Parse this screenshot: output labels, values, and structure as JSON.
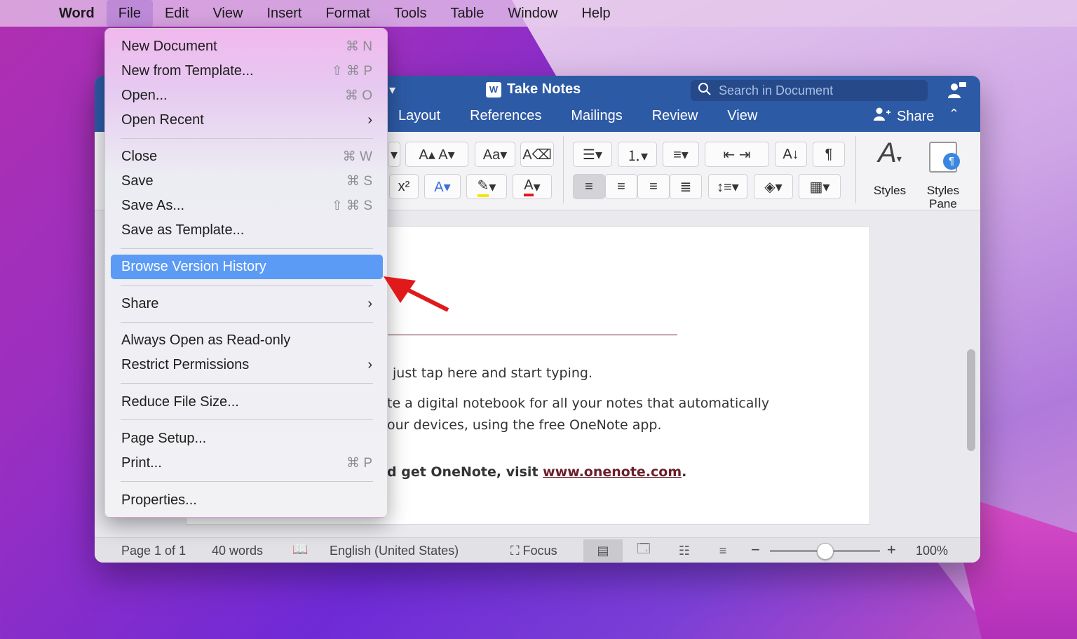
{
  "menubar": {
    "items": [
      "Word",
      "File",
      "Edit",
      "View",
      "Insert",
      "Format",
      "Tools",
      "Table",
      "Window",
      "Help"
    ]
  },
  "window": {
    "title": "Take Notes",
    "search_placeholder": "Search in Document",
    "tabs": [
      "Layout",
      "References",
      "Mailings",
      "Review",
      "View"
    ],
    "share_label": "Share",
    "ribbon": {
      "styles_label": "Styles",
      "styles_pane_label": "Styles Pane"
    }
  },
  "document": {
    "line1": "just tap here and start typing.",
    "line2": "te a digital notebook for all your notes that automatically",
    "line3": "our devices, using the free OneNote app.",
    "line4_prefix": "d get OneNote, visit ",
    "line4_link": "www.onenote.com",
    "line4_suffix": "."
  },
  "status": {
    "page": "Page 1 of 1",
    "words": "40 words",
    "language": "English (United States)",
    "focus": "Focus",
    "zoom": "100%",
    "zoom_level": 0.5
  },
  "file_menu": {
    "items": [
      {
        "label": "New Document",
        "shortcut": "⌘ N"
      },
      {
        "label": "New from Template...",
        "shortcut": "⇧ ⌘ P"
      },
      {
        "label": "Open...",
        "shortcut": "⌘ O"
      },
      {
        "label": "Open Recent",
        "submenu": true
      },
      {
        "label": "Close",
        "shortcut": "⌘ W"
      },
      {
        "label": "Save",
        "shortcut": "⌘ S"
      },
      {
        "label": "Save As...",
        "shortcut": "⇧ ⌘ S"
      },
      {
        "label": "Save as Template..."
      },
      {
        "label": "Browse Version History",
        "highlighted": true
      },
      {
        "label": "Share",
        "submenu": true
      },
      {
        "label": "Always Open as Read-only"
      },
      {
        "label": "Restrict Permissions",
        "submenu": true
      },
      {
        "label": "Reduce File Size..."
      },
      {
        "label": "Page Setup..."
      },
      {
        "label": "Print...",
        "shortcut": "⌘ P"
      },
      {
        "label": "Properties..."
      }
    ]
  },
  "colors": {
    "titlebar": "#2d5aa5",
    "highlight": "#5b9bf5",
    "annotation_arrow": "#e0191b"
  }
}
